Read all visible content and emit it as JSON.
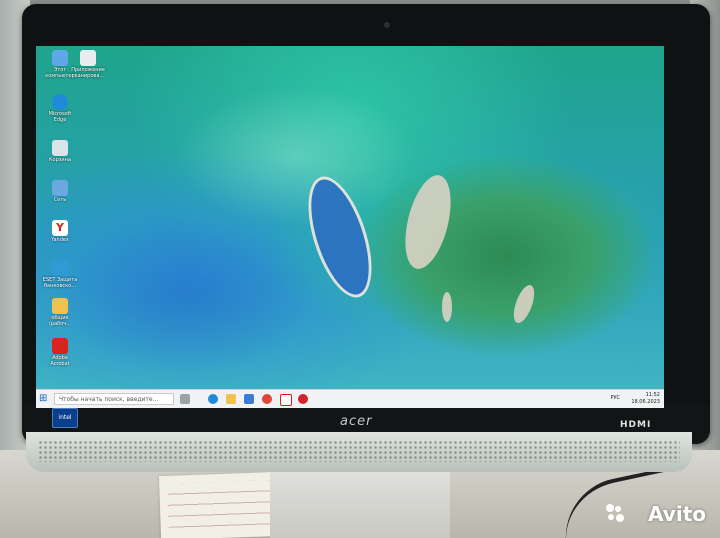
{
  "desktop": {
    "icons": [
      {
        "label": "Этот компьютер",
        "icon": "computer-icon",
        "color": "#5ea8e8"
      },
      {
        "label": "Приложение сканирова...",
        "icon": "scanner-icon",
        "color": "#e8ecef"
      },
      {
        "label": "Microsoft Edge",
        "icon": "edge-icon",
        "color": "#1f8ad8"
      },
      {
        "label": "Корзина",
        "icon": "recycle-bin-icon",
        "color": "#d9e3ea"
      },
      {
        "label": "Сеть",
        "icon": "network-icon",
        "color": "#6aa8e0"
      },
      {
        "label": "Yandex",
        "icon": "yandex-icon",
        "color": "#ffffff"
      },
      {
        "label": "ESET Защита банковско...",
        "icon": "eset-icon",
        "color": "#2f9ad6"
      },
      {
        "label": "общие (рабоч...",
        "icon": "folder-icon",
        "color": "#f2c14e"
      },
      {
        "label": "Adobe Acrobat",
        "icon": "acrobat-icon",
        "color": "#d9241c"
      }
    ]
  },
  "taskbar": {
    "start_icon": "windows-start-icon",
    "search_placeholder": "Чтобы начать поиск, введите...",
    "apps": [
      "task-view-icon",
      "edge-icon",
      "file-explorer-icon",
      "store-icon",
      "chrome-icon",
      "yandex-icon",
      "opera-icon"
    ],
    "language": "РУС",
    "time": "11:52",
    "date": "18.06.2023"
  },
  "hardware": {
    "brand": "acer",
    "port_label": "HDMI",
    "sticker": "intel"
  },
  "watermark": "Avito"
}
